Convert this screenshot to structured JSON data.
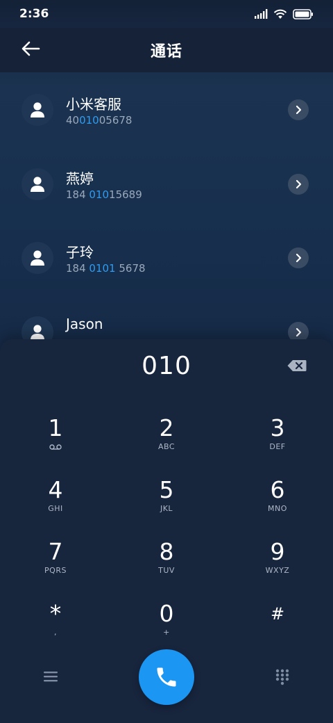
{
  "status_bar": {
    "time": "2:36",
    "icons": [
      "signal-icon",
      "wifi-icon",
      "battery-icon"
    ]
  },
  "header": {
    "title": "通话",
    "back_icon": "arrow-left-icon"
  },
  "contacts": [
    {
      "name": "小米客服",
      "number_pre": "40",
      "number_hl": "010",
      "number_post": "05678"
    },
    {
      "name": "燕婷",
      "number_pre": "184 ",
      "number_hl": "010",
      "number_post": "15689"
    },
    {
      "name": "子玲",
      "number_pre": "184 ",
      "number_hl": "0101",
      "number_post": " 5678"
    },
    {
      "name": "Jason",
      "number_pre": "",
      "number_hl": "",
      "number_post": ""
    }
  ],
  "dialer": {
    "input": "010",
    "keys": [
      {
        "digit": "1",
        "sub": "voicemail-icon"
      },
      {
        "digit": "2",
        "sub": "ABC"
      },
      {
        "digit": "3",
        "sub": "DEF"
      },
      {
        "digit": "4",
        "sub": "GHI"
      },
      {
        "digit": "5",
        "sub": "JKL"
      },
      {
        "digit": "6",
        "sub": "MNO"
      },
      {
        "digit": "7",
        "sub": "PQRS"
      },
      {
        "digit": "8",
        "sub": "TUV"
      },
      {
        "digit": "9",
        "sub": "WXYZ"
      },
      {
        "digit": "*",
        "sub": ","
      },
      {
        "digit": "0",
        "sub": "+"
      },
      {
        "digit": "#",
        "sub": ""
      }
    ]
  },
  "colors": {
    "accent": "#1b96f3",
    "highlight": "#2f9cf1",
    "background": "#16243a"
  }
}
